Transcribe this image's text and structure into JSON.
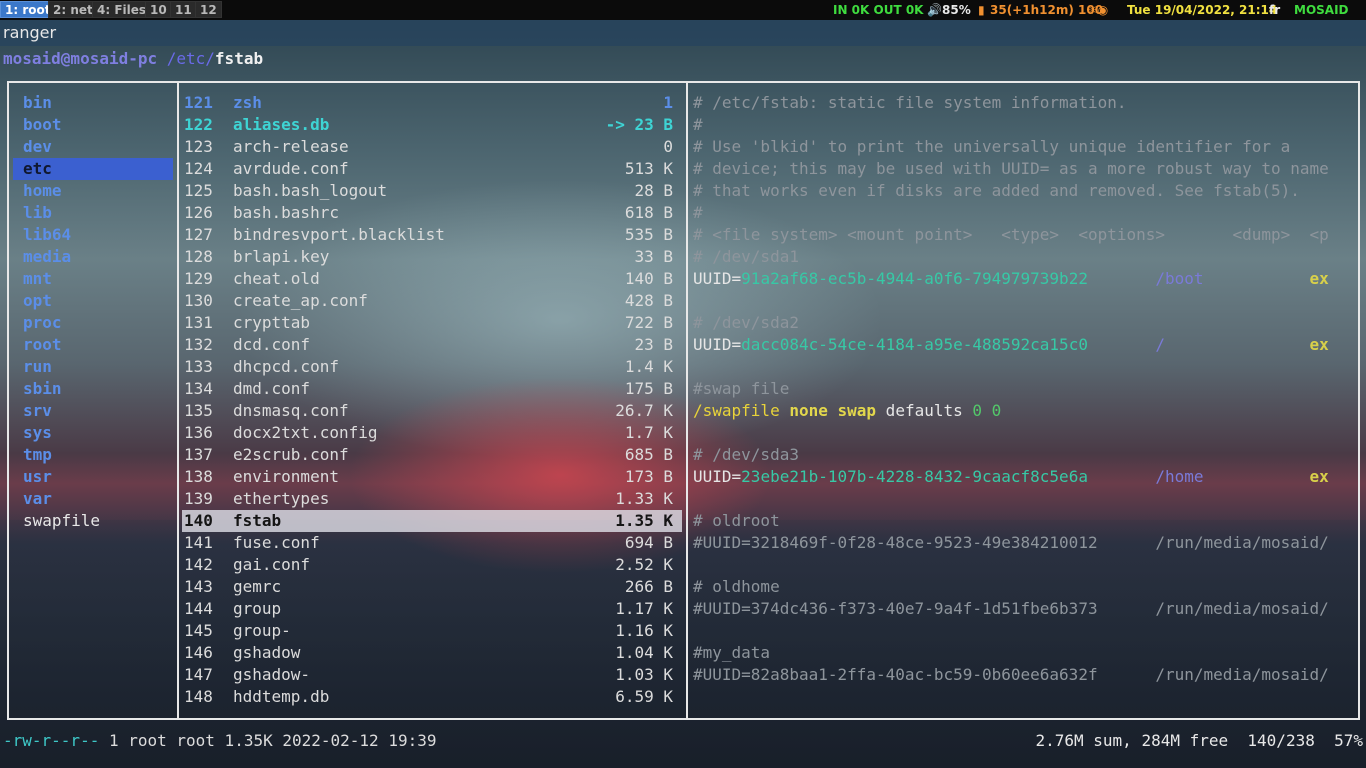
{
  "topbar": {
    "workspaces": [
      "1: root",
      "2: net",
      "4: Files",
      "10",
      "11",
      "12"
    ],
    "active_workspace": "1: root",
    "network": "IN 0K OUT 0K",
    "volume": "85%",
    "battery": "35(+1h12m) 100",
    "datetime": "Tue 19/04/2022, 21:14",
    "keyboard_layout": "fr",
    "hostname": "MOSAID"
  },
  "window": {
    "title": "ranger"
  },
  "path": {
    "user_host": "mosaid@mosaid-pc",
    "dir": " /etc/",
    "file": "fstab"
  },
  "parent_dirs": [
    "bin",
    "boot",
    "dev",
    "etc",
    "home",
    "lib",
    "lib64",
    "media",
    "mnt",
    "opt",
    "proc",
    "root",
    "run",
    "sbin",
    "srv",
    "sys",
    "tmp",
    "usr",
    "var",
    "swapfile"
  ],
  "parent_selected": "etc",
  "files": [
    {
      "n": "121",
      "name": "zsh",
      "size": "1"
    },
    {
      "n": "122",
      "name": "aliases.db",
      "size": "-> 23 B"
    },
    {
      "n": "123",
      "name": "arch-release",
      "size": "0"
    },
    {
      "n": "124",
      "name": "avrdude.conf",
      "size": "513 K"
    },
    {
      "n": "125",
      "name": "bash.bash_logout",
      "size": "28 B"
    },
    {
      "n": "126",
      "name": "bash.bashrc",
      "size": "618 B"
    },
    {
      "n": "127",
      "name": "bindresvport.blacklist",
      "size": "535 B"
    },
    {
      "n": "128",
      "name": "brlapi.key",
      "size": "33 B"
    },
    {
      "n": "129",
      "name": "cheat.old",
      "size": "140 B"
    },
    {
      "n": "130",
      "name": "create_ap.conf",
      "size": "428 B"
    },
    {
      "n": "131",
      "name": "crypttab",
      "size": "722 B"
    },
    {
      "n": "132",
      "name": "dcd.conf",
      "size": "23 B"
    },
    {
      "n": "133",
      "name": "dhcpcd.conf",
      "size": "1.4 K"
    },
    {
      "n": "134",
      "name": "dmd.conf",
      "size": "175 B"
    },
    {
      "n": "135",
      "name": "dnsmasq.conf",
      "size": "26.7 K"
    },
    {
      "n": "136",
      "name": "docx2txt.config",
      "size": "1.7 K"
    },
    {
      "n": "137",
      "name": "e2scrub.conf",
      "size": "685 B"
    },
    {
      "n": "138",
      "name": "environment",
      "size": "173 B"
    },
    {
      "n": "139",
      "name": "ethertypes",
      "size": "1.33 K"
    },
    {
      "n": "140",
      "name": "fstab",
      "size": "1.35 K"
    },
    {
      "n": "141",
      "name": "fuse.conf",
      "size": "694 B"
    },
    {
      "n": "142",
      "name": "gai.conf",
      "size": "2.52 K"
    },
    {
      "n": "143",
      "name": "gemrc",
      "size": "266 B"
    },
    {
      "n": "144",
      "name": "group",
      "size": "1.17 K"
    },
    {
      "n": "145",
      "name": "group-",
      "size": "1.16 K"
    },
    {
      "n": "146",
      "name": "gshadow",
      "size": "1.04 K"
    },
    {
      "n": "147",
      "name": "gshadow-",
      "size": "1.03 K"
    },
    {
      "n": "148",
      "name": "hddtemp.db",
      "size": "6.59 K"
    }
  ],
  "selected_file": "fstab",
  "preview": [
    "# /etc/fstab: static file system information.",
    "#",
    "# Use 'blkid' to print the universally unique identifier for a",
    "# device; this may be used with UUID= as a more robust way to name",
    "# that works even if disks are added and removed. See fstab(5).",
    "#",
    "# <file system> <mount point>   <type>  <options>       <dump>  <p",
    "# /dev/sda1",
    "UUID=91a2af68-ec5b-4944-a0f6-794979739b22       /boot           ex",
    "",
    "# /dev/sda2",
    "UUID=dacc084c-54ce-4184-a95e-488592ca15c0       /               ex",
    "",
    "#swap file",
    "/swapfile none swap defaults 0 0",
    "",
    "# /dev/sda3",
    "UUID=23ebe21b-107b-4228-8432-9caacf8c5e6a       /home           ex",
    "",
    "# oldroot",
    "#UUID=3218469f-0f28-48ce-9523-49e384210012      /run/media/mosaid/",
    "",
    "# oldhome",
    "#UUID=374dc436-f373-40e7-9a4f-1d51fbe6b373      /run/media/mosaid/",
    "",
    "#my_data",
    "#UUID=82a8baa1-2ffa-40ac-bc59-0b60ee6a632f      /run/media/mosaid/"
  ],
  "status": {
    "permissions": "-rw-r--r--",
    "info": " 1 root root 1.35K 2022-02-12 19:39",
    "summary": "2.76M sum, 284M free  140/238  57%"
  },
  "colors": {
    "selection": "#3b60d0",
    "directory": "#5b8ee8",
    "link": "#3ed4d4",
    "frame": "#e8e8e8"
  }
}
